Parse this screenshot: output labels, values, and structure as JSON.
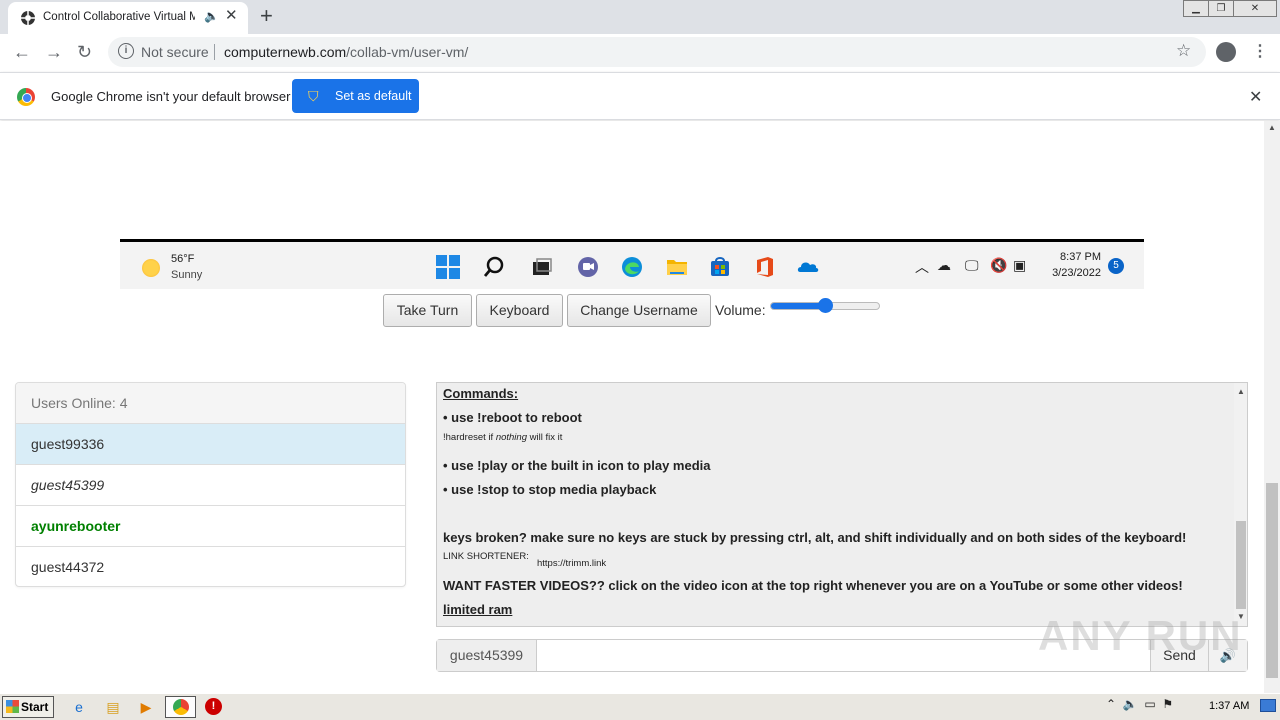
{
  "browser": {
    "tab_title": "Control Collaborative Virtual Ma",
    "url_security": "Not secure",
    "url_domain": "computernewb.com",
    "url_path": "/collab-vm/user-vm/"
  },
  "infobar": {
    "message": "Google Chrome isn't your default browser",
    "button_label": "Set as default"
  },
  "vm_taskbar": {
    "temperature": "56°F",
    "condition": "Sunny",
    "time": "8:37 PM",
    "date": "3/23/2022",
    "notification_count": "5",
    "icons": [
      "start-icon",
      "search-icon",
      "task-view-icon",
      "chat-icon",
      "edge-icon",
      "file-explorer-icon",
      "store-icon",
      "office-icon",
      "onedrive-icon"
    ]
  },
  "controls": {
    "take_turn": "Take Turn",
    "keyboard": "Keyboard",
    "change_username": "Change Username",
    "volume_label": "Volume:",
    "volume_level": 0.5
  },
  "users": {
    "heading": "Users Online: 4",
    "list": [
      "guest99336",
      "guest45399",
      "ayunrebooter",
      "guest44372"
    ]
  },
  "chat": {
    "commands_title": "Commands:",
    "line_reboot": "• use !reboot to reboot",
    "hardreset_pre": "!hardreset if ",
    "hardreset_em": "nothing",
    "hardreset_post": " will fix it",
    "line_play": "• use !play or the built in icon to play media",
    "line_stop": "• use !stop to stop media playback",
    "line_keys": "keys broken? make sure no keys are stuck by pressing ctrl, alt, and shift individually and on both sides of the keyboard!",
    "shortener_label": "LINK SHORTENER:",
    "shortener_url": "https://trimm.link",
    "line_videos": "WANT FASTER VIDEOS?? click on the video icon at the top right whenever you are on a YouTube or some other videos!",
    "limited_ram": "limited ram"
  },
  "chat_input": {
    "username": "guest45399",
    "value": "",
    "send_label": "Send"
  },
  "watermark": "ANY RUN",
  "host_taskbar": {
    "start_label": "Start",
    "clock": "1:37 AM"
  }
}
